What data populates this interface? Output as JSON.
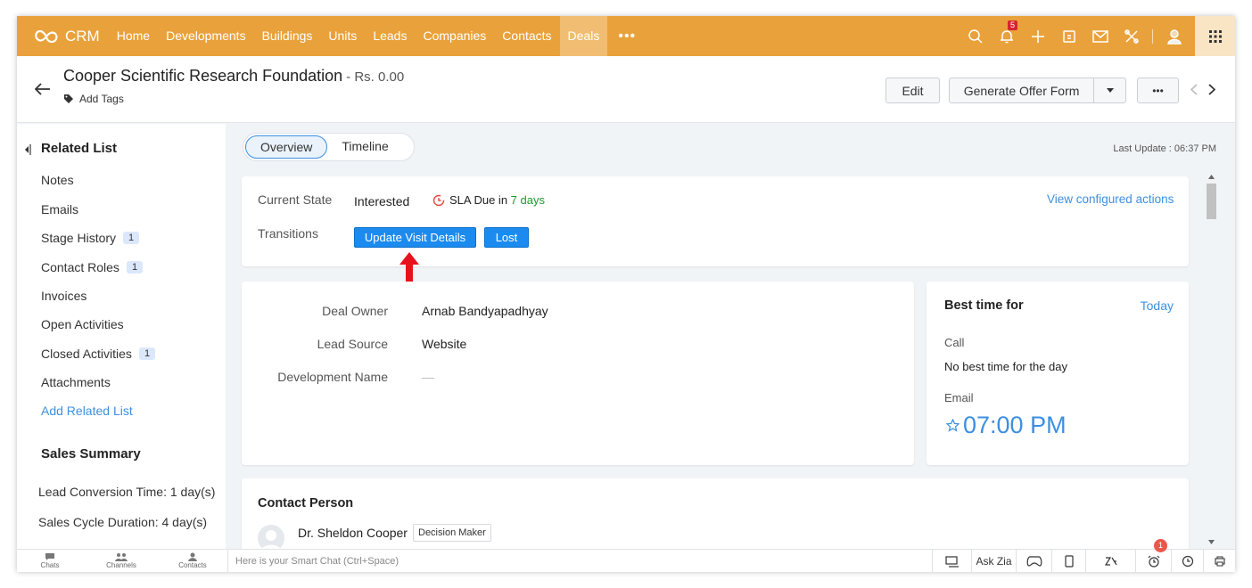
{
  "app": {
    "logo_text": "CRM"
  },
  "nav": {
    "items": [
      "Home",
      "Developments",
      "Buildings",
      "Units",
      "Leads",
      "Companies",
      "Contacts",
      "Deals"
    ],
    "active": "Deals",
    "more": "•••",
    "notification_count": "5"
  },
  "record": {
    "title": "Cooper Scientific Research Foundation",
    "amount": "- Rs. 0.00",
    "add_tags": "Add Tags",
    "edit_label": "Edit",
    "offer_label": "Generate Offer Form",
    "more_label": "•••"
  },
  "sidebar": {
    "heading": "Related List",
    "items": [
      {
        "label": "Notes",
        "count": ""
      },
      {
        "label": "Emails",
        "count": ""
      },
      {
        "label": "Stage History",
        "count": "1"
      },
      {
        "label": "Contact Roles",
        "count": "1"
      },
      {
        "label": "Invoices",
        "count": ""
      },
      {
        "label": "Open Activities",
        "count": ""
      },
      {
        "label": "Closed Activities",
        "count": "1"
      },
      {
        "label": "Attachments",
        "count": ""
      }
    ],
    "add_related": "Add Related List",
    "summary_heading": "Sales Summary",
    "lead_conversion": "Lead Conversion Time: 1 day(s)",
    "sales_cycle": "Sales Cycle Duration: 4 day(s)"
  },
  "tabs": {
    "overview": "Overview",
    "timeline": "Timeline"
  },
  "last_update": "Last Update : 06:37 PM",
  "blueprint": {
    "current_state_label": "Current State",
    "current_state_value": "Interested",
    "sla_prefix": "SLA Due in ",
    "sla_days": "7 days",
    "view_actions": "View configured actions",
    "transitions_label": "Transitions",
    "transition_1": "Update Visit Details",
    "transition_2": "Lost"
  },
  "details": {
    "deal_owner_label": "Deal Owner",
    "deal_owner_value": "Arnab Bandyapadhyay",
    "lead_source_label": "Lead Source",
    "lead_source_value": "Website",
    "development_label": "Development Name",
    "development_value": "—"
  },
  "best_time": {
    "heading": "Best time for",
    "today": "Today",
    "call_label": "Call",
    "call_value": "No best time for the day",
    "email_label": "Email",
    "email_value": "07:00 PM"
  },
  "contact": {
    "heading": "Contact Person",
    "name": "Dr. Sheldon Cooper",
    "role": "Decision Maker"
  },
  "bottom": {
    "chats": "Chats",
    "channels": "Channels",
    "contacts": "Contacts",
    "smart_chat": "Here is your Smart Chat (Ctrl+Space)",
    "ask_zia": "Ask Zia",
    "alarm_count": "1"
  },
  "colors": {
    "nav": "#e9a23b",
    "accent": "#1c8bf0",
    "link": "#3d8fe0",
    "annotation_arrow": "#e8121e"
  }
}
